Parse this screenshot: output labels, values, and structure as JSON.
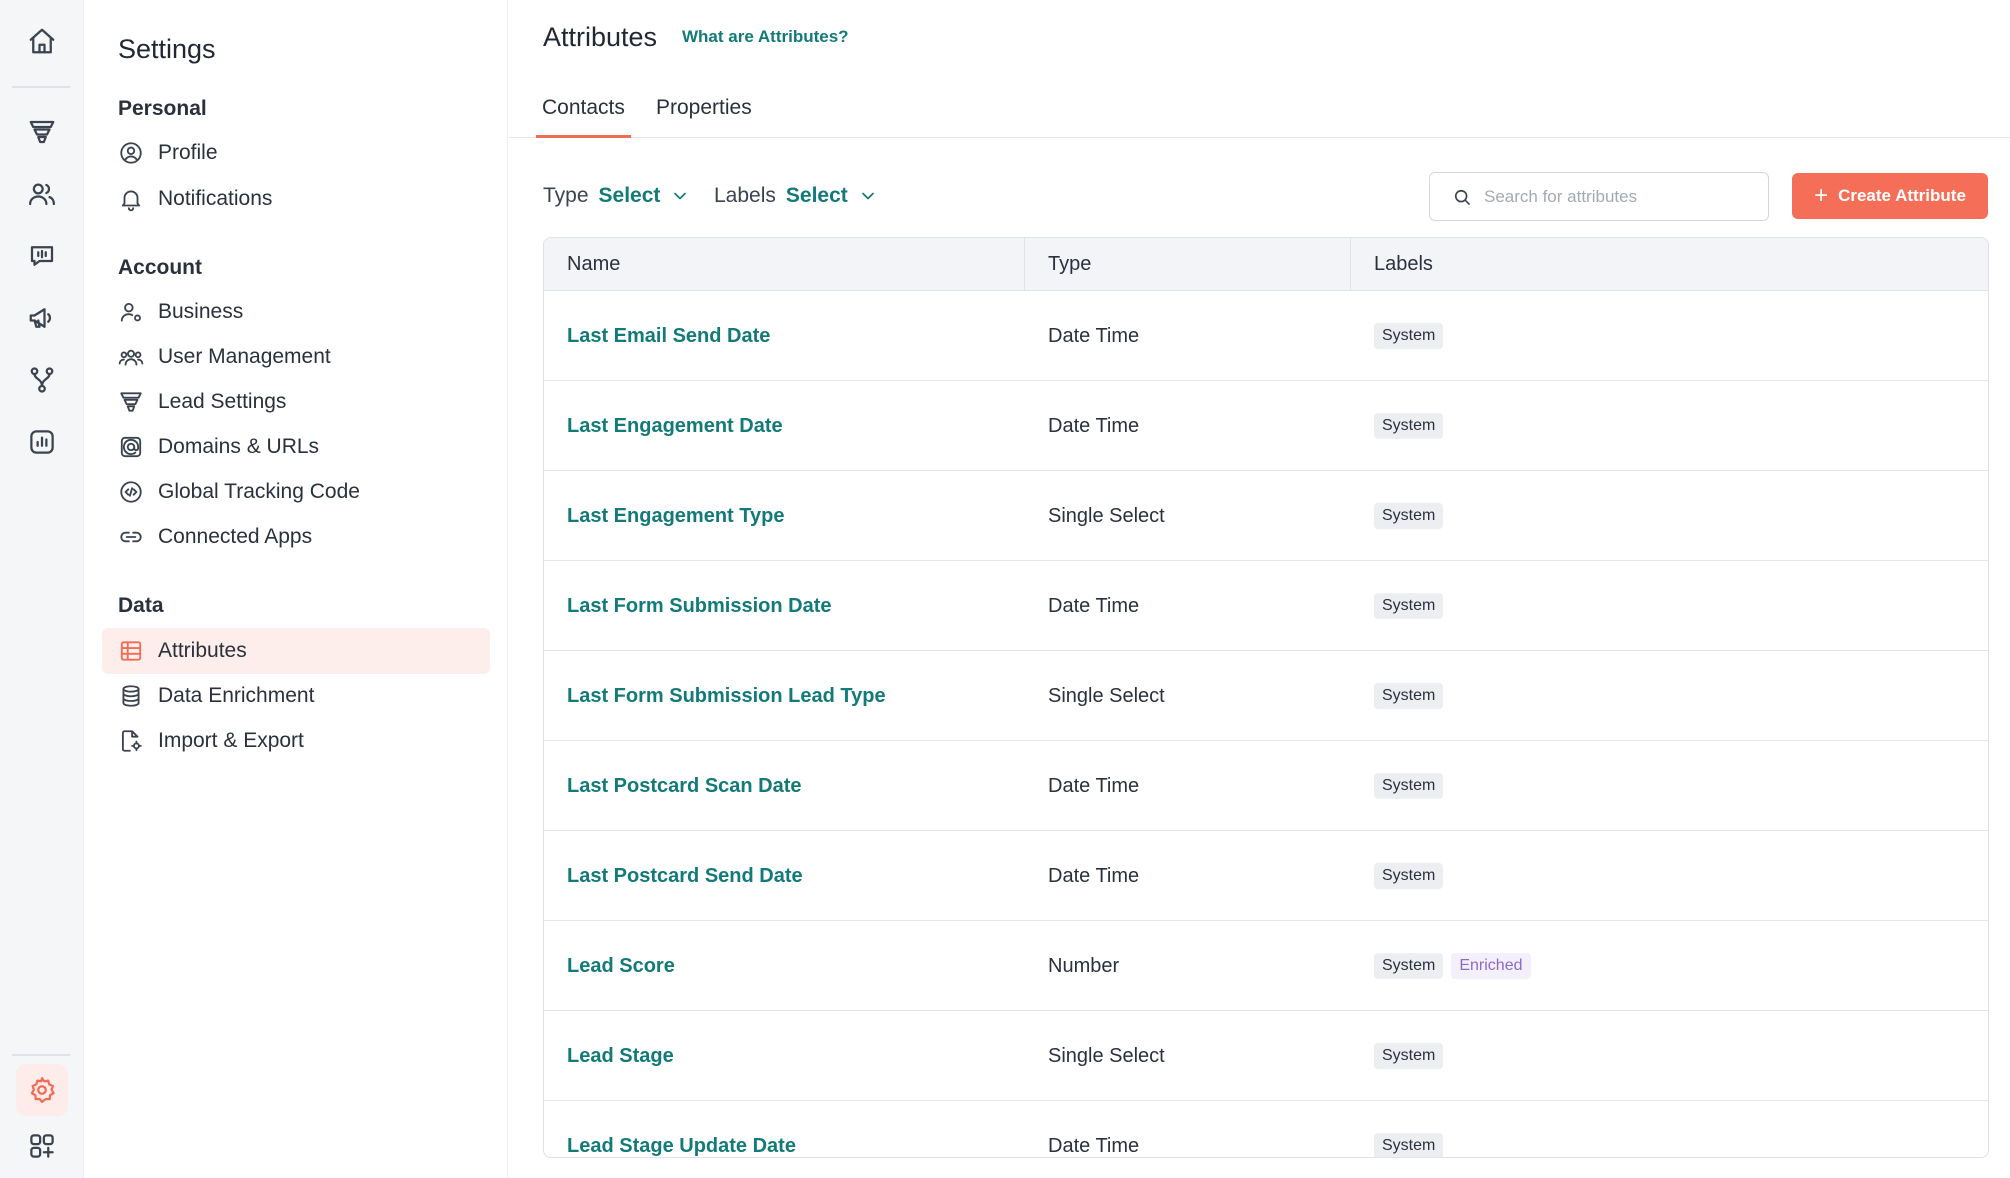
{
  "rail": {
    "icons": [
      "home-icon",
      "funnel-icon",
      "users-icon",
      "conversations-icon",
      "megaphone-icon",
      "workflow-icon",
      "reports-icon",
      "settings-icon",
      "apps-icon"
    ]
  },
  "settings_nav": {
    "title": "Settings",
    "sections": [
      {
        "heading": "Personal",
        "items": [
          "Profile",
          "Notifications"
        ]
      },
      {
        "heading": "Account",
        "items": [
          "Business",
          "User Management",
          "Lead Settings",
          "Domains & URLs",
          "Global Tracking Code",
          "Connected Apps"
        ]
      },
      {
        "heading": "Data",
        "items": [
          "Attributes",
          "Data Enrichment",
          "Import & Export"
        ]
      }
    ],
    "active_item": "Attributes",
    "active_color": "#f26b55"
  },
  "main": {
    "title": "Attributes",
    "help_link": "What are Attributes?",
    "tabs": [
      {
        "label": "Contacts",
        "active": true
      },
      {
        "label": "Properties",
        "active": false
      }
    ],
    "filters": [
      {
        "label": "Type",
        "value": "Select"
      },
      {
        "label": "Labels",
        "value": "Select"
      }
    ],
    "search": {
      "placeholder": "Search for attributes",
      "value": ""
    },
    "create_button": {
      "label": "Create Attribute",
      "color": "#f56e58"
    },
    "accent_color": "#127a78"
  },
  "table": {
    "columns": [
      "Name",
      "Type",
      "Labels"
    ],
    "rows": [
      {
        "name": "Last Email Send Date",
        "type": "Date Time",
        "labels": [
          "System"
        ]
      },
      {
        "name": "Last Engagement Date",
        "type": "Date Time",
        "labels": [
          "System"
        ]
      },
      {
        "name": "Last Engagement Type",
        "type": "Single Select",
        "labels": [
          "System"
        ]
      },
      {
        "name": "Last Form Submission Date",
        "type": "Date Time",
        "labels": [
          "System"
        ]
      },
      {
        "name": "Last Form Submission Lead Type",
        "type": "Single Select",
        "labels": [
          "System"
        ]
      },
      {
        "name": "Last Postcard Scan Date",
        "type": "Date Time",
        "labels": [
          "System"
        ]
      },
      {
        "name": "Last Postcard Send Date",
        "type": "Date Time",
        "labels": [
          "System"
        ]
      },
      {
        "name": "Lead Score",
        "type": "Number",
        "labels": [
          "System",
          "Enriched"
        ]
      },
      {
        "name": "Lead Stage",
        "type": "Single Select",
        "labels": [
          "System"
        ]
      },
      {
        "name": "Lead Stage Update Date",
        "type": "Date Time",
        "labels": [
          "System"
        ]
      }
    ]
  }
}
